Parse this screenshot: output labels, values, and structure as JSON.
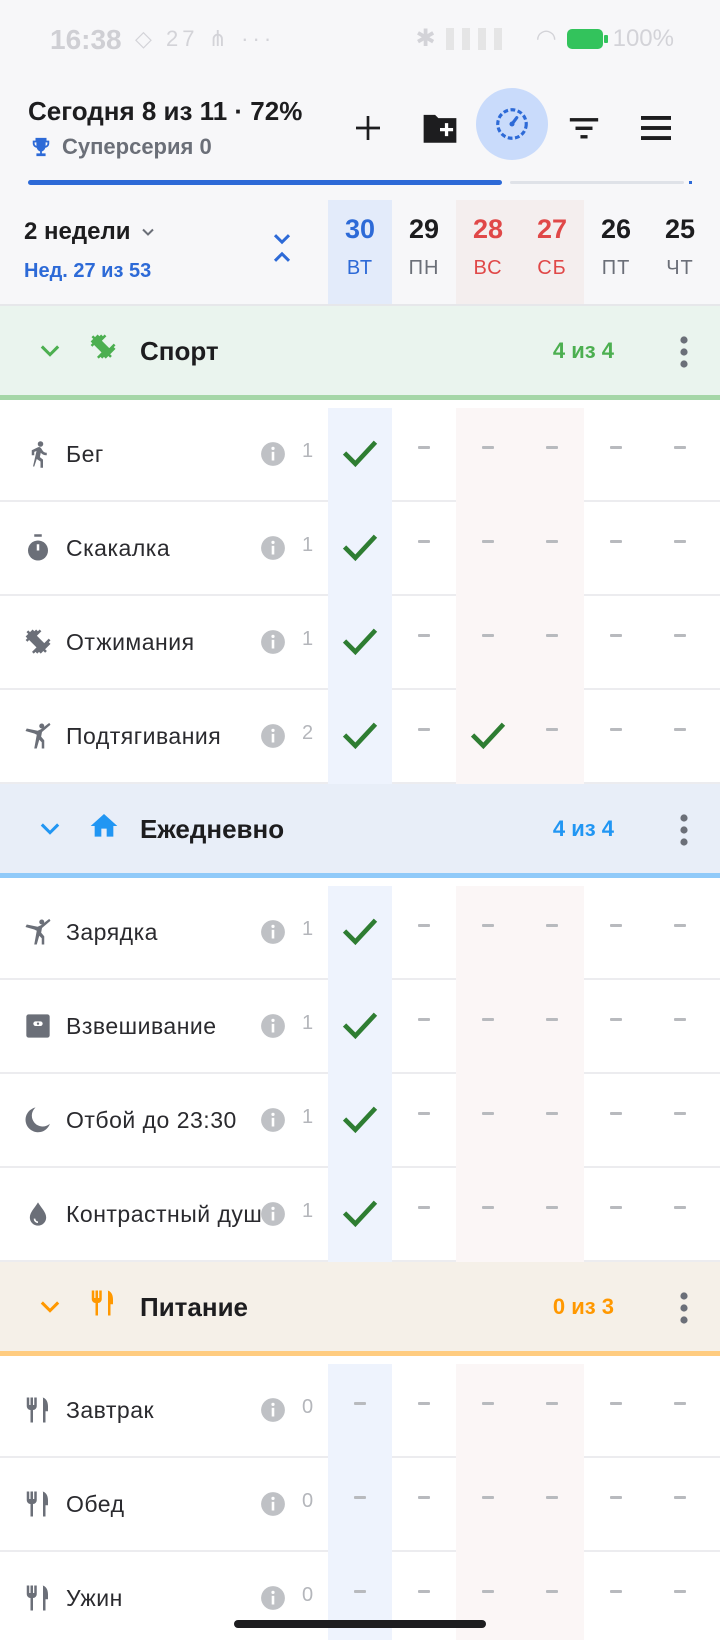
{
  "status_bar": {
    "time": "16:38",
    "left_icons": "◇ 27 ⋔ ···",
    "battery": "100%"
  },
  "header": {
    "today_text": "Сегодня 8 из 11 · 72%",
    "streak_text": "Суперсерия 0",
    "progress_percent": 72
  },
  "range": {
    "label": "2 недели",
    "week_label": "Нед. 27 из 53"
  },
  "days": [
    {
      "num": "30",
      "dow": "ВТ",
      "kind": "today"
    },
    {
      "num": "29",
      "dow": "ПН",
      "kind": "normal"
    },
    {
      "num": "28",
      "dow": "ВС",
      "kind": "weekend"
    },
    {
      "num": "27",
      "dow": "СБ",
      "kind": "weekend"
    },
    {
      "num": "26",
      "dow": "ПТ",
      "kind": "normal"
    },
    {
      "num": "25",
      "dow": "ЧТ",
      "kind": "normal"
    }
  ],
  "groups": [
    {
      "name": "Спорт",
      "count": "4 из 4",
      "icon": "dumbbell-icon",
      "color": "#4caf50",
      "bg": "#eaf4ee",
      "line": "#a5d6a7",
      "habits": [
        {
          "name": "Бег",
          "count": "1",
          "icon": "running-icon",
          "marks": [
            true,
            false,
            false,
            false,
            false,
            false
          ]
        },
        {
          "name": "Скакалка",
          "count": "1",
          "icon": "stopwatch-icon",
          "marks": [
            true,
            false,
            false,
            false,
            false,
            false
          ]
        },
        {
          "name": "Отжимания",
          "count": "1",
          "icon": "dumbbell-icon",
          "marks": [
            true,
            false,
            false,
            false,
            false,
            false
          ]
        },
        {
          "name": "Подтягивания",
          "count": "2",
          "icon": "gymnast-icon",
          "marks": [
            true,
            false,
            true,
            false,
            false,
            false
          ]
        }
      ]
    },
    {
      "name": "Ежедневно",
      "count": "4 из 4",
      "icon": "home-icon",
      "color": "#2196f3",
      "bg": "#e8eef8",
      "line": "#90caf9",
      "habits": [
        {
          "name": "Зарядка",
          "count": "1",
          "icon": "gymnast-icon",
          "marks": [
            true,
            false,
            false,
            false,
            false,
            false
          ]
        },
        {
          "name": "Взвешивание",
          "count": "1",
          "icon": "scale-icon",
          "marks": [
            true,
            false,
            false,
            false,
            false,
            false
          ]
        },
        {
          "name": "Отбой до 23:30",
          "count": "1",
          "icon": "moon-icon",
          "marks": [
            true,
            false,
            false,
            false,
            false,
            false
          ]
        },
        {
          "name": "Контрастный душ",
          "count": "1",
          "icon": "drop-icon",
          "marks": [
            true,
            false,
            false,
            false,
            false,
            false
          ]
        }
      ]
    },
    {
      "name": "Питание",
      "count": "0 из 3",
      "icon": "cutlery-icon",
      "color": "#ff9800",
      "bg": "#f5f0e8",
      "line": "#ffcc80",
      "habits": [
        {
          "name": "Завтрак",
          "count": "0",
          "icon": "cutlery-icon",
          "marks": [
            false,
            false,
            false,
            false,
            false,
            false
          ]
        },
        {
          "name": "Обед",
          "count": "0",
          "icon": "cutlery-icon",
          "marks": [
            false,
            false,
            false,
            false,
            false,
            false
          ]
        },
        {
          "name": "Ужин",
          "count": "0",
          "icon": "cutlery-icon",
          "marks": [
            false,
            false,
            false,
            false,
            false,
            false
          ]
        }
      ]
    }
  ],
  "colors": {
    "today": "#2d6ad7",
    "weekend": "#e04848",
    "check": "#2e7d32"
  }
}
